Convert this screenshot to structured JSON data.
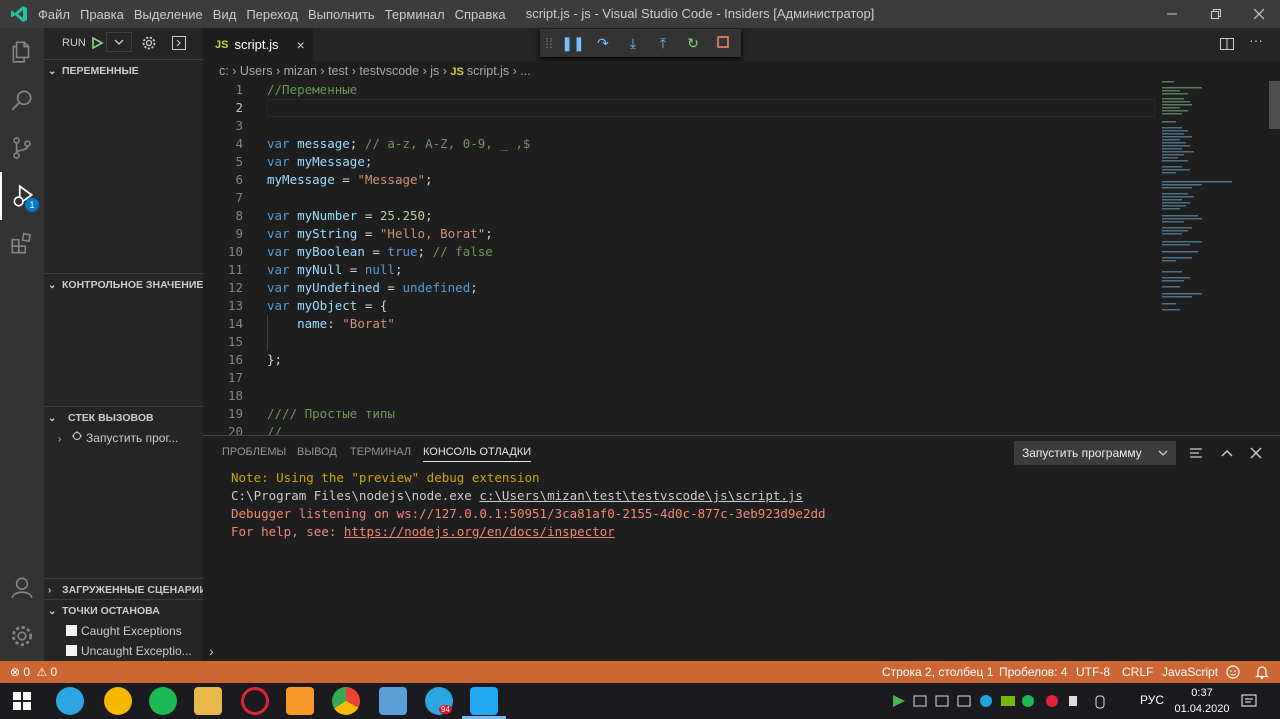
{
  "titlebar": {
    "menu": [
      "Файл",
      "Правка",
      "Выделение",
      "Вид",
      "Переход",
      "Выполнить",
      "Терминал",
      "Справка"
    ],
    "title": "script.js - js - Visual Studio Code - Insiders [Администратор]"
  },
  "activity": {
    "debug_badge": "1"
  },
  "sidebar": {
    "run_label": "RUN",
    "sections": {
      "variables": "ПЕРЕМЕННЫЕ",
      "watch": "КОНТРОЛЬНОЕ ЗНАЧЕНИЕ",
      "callstack": "СТЕК ВЫЗОВОВ",
      "scripts": "ЗАГРУЖЕННЫЕ СЦЕНАРИИ",
      "breakpoints": "ТОЧКИ ОСТАНОВА"
    },
    "callstack_item": "Запустить прог...",
    "breakpoints_items": [
      "Caught Exceptions",
      "Uncaught Exceptio..."
    ]
  },
  "tab": {
    "icon": "JS",
    "label": "script.js"
  },
  "breadcrumb": {
    "path": [
      "c:",
      "Users",
      "mizan",
      "test",
      "testvscode",
      "js"
    ],
    "file_icon": "JS",
    "file": "script.js",
    "more": "..."
  },
  "editor": {
    "line_numbers": [
      "1",
      "2",
      "3",
      "4",
      "5",
      "6",
      "7",
      "8",
      "9",
      "10",
      "11",
      "12",
      "13",
      "14",
      "15",
      "16",
      "17",
      "18",
      "19",
      "20"
    ]
  },
  "panel": {
    "tabs": [
      "ПРОБЛЕМЫ",
      "ВЫВОД",
      "ТЕРМИНАЛ",
      "КОНСОЛЬ ОТЛАДКИ"
    ],
    "dropdown": "Запустить программу",
    "lines": {
      "l1": "Note: Using the \"preview\" debug extension",
      "l2_prefix": "C:\\Program Files\\nodejs\\node.exe ",
      "l2_link": "c:\\Users\\mizan\\test\\testvscode\\js\\script.js",
      "l3": "Debugger listening on ws://127.0.0.1:50951/3ca81af0-2155-4d0c-877c-3eb923d9e2dd",
      "l4_prefix": "For help, see: ",
      "l4_link": "https://nodejs.org/en/docs/inspector"
    },
    "prompt": "›"
  },
  "status": {
    "errors": "0",
    "warnings": "0",
    "position": "Строка 2, столбец 1",
    "spaces": "Пробелов: 4",
    "encoding": "UTF-8",
    "eol": "CRLF",
    "language": "JavaScript"
  },
  "taskbar": {
    "lang": "РУС",
    "time": "0:37",
    "date": "01.04.2020",
    "telegram_badge": "94"
  },
  "colors": {
    "statusbar": "#cc6633",
    "accent": "#007acc"
  }
}
